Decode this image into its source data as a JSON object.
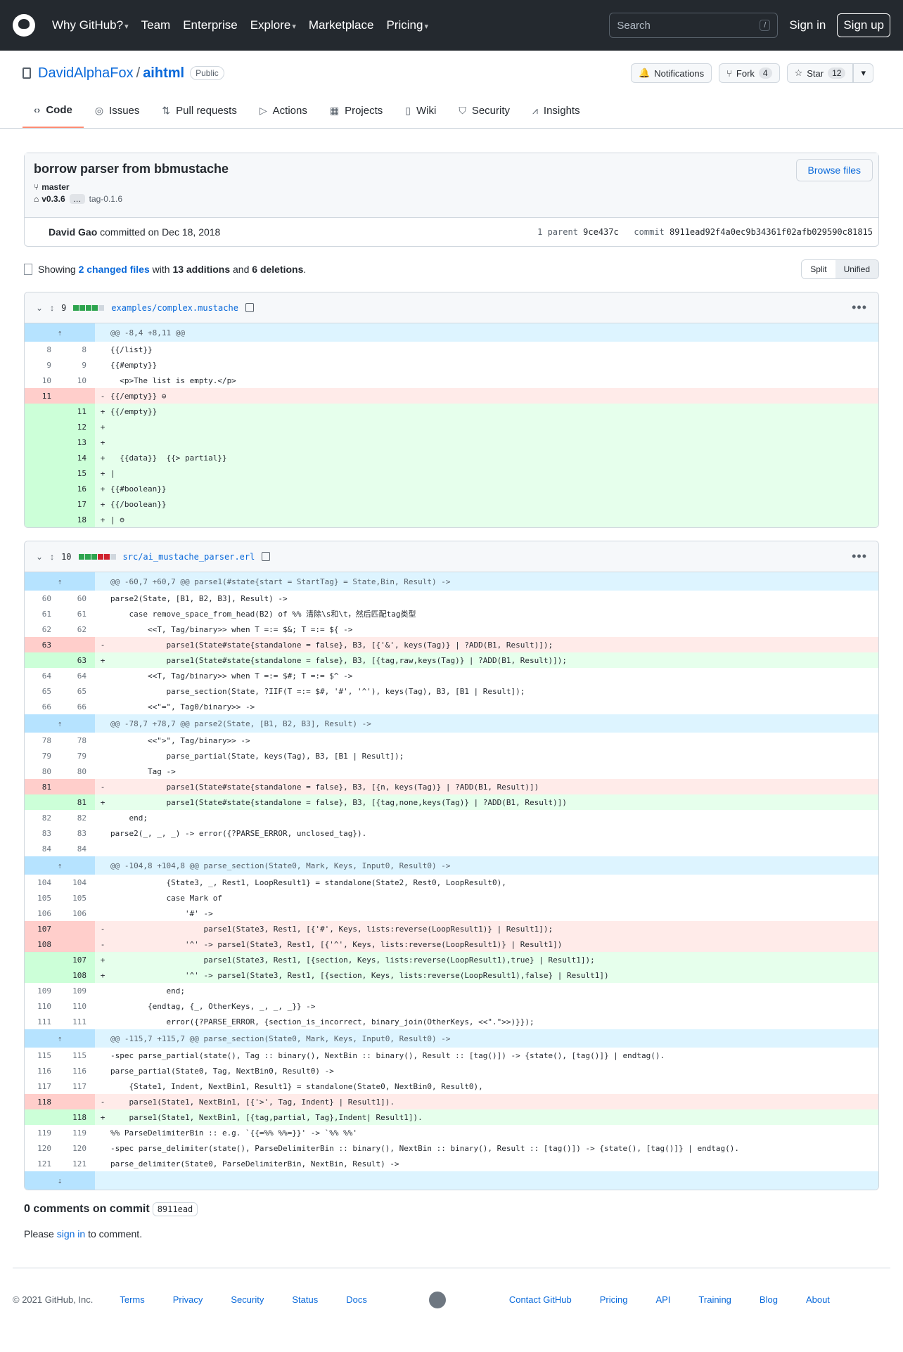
{
  "header": {
    "nav": [
      "Why GitHub?",
      "Team",
      "Enterprise",
      "Explore",
      "Marketplace",
      "Pricing"
    ],
    "nav_caret": [
      true,
      false,
      false,
      true,
      false,
      true
    ],
    "search_placeholder": "Search",
    "search_key": "/",
    "signin": "Sign in",
    "signup": "Sign up"
  },
  "repo": {
    "owner": "DavidAlphaFox",
    "sep": "/",
    "name": "aihtml",
    "visibility": "Public",
    "notifications": "Notifications",
    "fork": "Fork",
    "fork_count": "4",
    "star": "Star",
    "star_count": "12",
    "tabs": [
      {
        "label": "Code",
        "icon": "code-icon"
      },
      {
        "label": "Issues",
        "icon": "issue-icon"
      },
      {
        "label": "Pull requests",
        "icon": "pull-request-icon"
      },
      {
        "label": "Actions",
        "icon": "play-icon"
      },
      {
        "label": "Projects",
        "icon": "table-icon"
      },
      {
        "label": "Wiki",
        "icon": "book-icon"
      },
      {
        "label": "Security",
        "icon": "shield-icon"
      },
      {
        "label": "Insights",
        "icon": "graph-icon"
      }
    ]
  },
  "commit": {
    "title": "borrow parser from bbmustache",
    "browse": "Browse files",
    "branch": "master",
    "tag": "v0.3.6",
    "tag_more": "…",
    "tag2": "tag-0.1.6",
    "author": "David Gao",
    "committed": "committed on Dec 18, 2018",
    "parents": "1 parent",
    "parent_sha": "9ce437c",
    "commit_label": "commit",
    "commit_sha": "8911ead92f4a0ec9b34361f02afb029590c81815"
  },
  "summary": {
    "showing": "Showing",
    "changed": "2 changed files",
    "with": "with",
    "additions": "13 additions",
    "and": "and",
    "deletions": "6 deletions",
    "end": ".",
    "split": "Split",
    "unified": "Unified"
  },
  "files": [
    {
      "count": "9",
      "blocks": "ggggn",
      "path": "examples/complex.mustache",
      "lines": [
        [
          "h",
          "",
          "",
          "",
          "@@ -8,4 +8,11 @@"
        ],
        [
          "c",
          "8",
          "8",
          "",
          "{{/list}}"
        ],
        [
          "c",
          "9",
          "9",
          "",
          "{{#empty}}"
        ],
        [
          "c",
          "10",
          "10",
          "",
          "  <p>The list is empty.</p>"
        ],
        [
          "d",
          "11",
          "",
          "-",
          "{{/empty}} ⊖"
        ],
        [
          "a",
          "",
          "11",
          "+",
          "{{/empty}}"
        ],
        [
          "a",
          "",
          "12",
          "+",
          ""
        ],
        [
          "a",
          "",
          "13",
          "+",
          ""
        ],
        [
          "a",
          "",
          "14",
          "+",
          "  {{data}}  {{> partial}}"
        ],
        [
          "a",
          "",
          "15",
          "+",
          "|"
        ],
        [
          "a",
          "",
          "16",
          "+",
          "{{#boolean}}"
        ],
        [
          "a",
          "",
          "17",
          "+",
          "{{/boolean}}"
        ],
        [
          "a",
          "",
          "18",
          "+",
          "| ⊖"
        ]
      ]
    },
    {
      "count": "10",
      "blocks": "gggrrn",
      "path": "src/ai_mustache_parser.erl",
      "lines": [
        [
          "h",
          "",
          "",
          "",
          "@@ -60,7 +60,7 @@ parse1(#state{start = StartTag} = State,Bin, Result) ->"
        ],
        [
          "c",
          "60",
          "60",
          "",
          "parse2(State, [B1, B2, B3], Result) ->"
        ],
        [
          "c",
          "61",
          "61",
          "",
          "    case remove_space_from_head(B2) of %% 清除\\s和\\t，然后匹配tag类型"
        ],
        [
          "c",
          "62",
          "62",
          "",
          "        <<T, Tag/binary>> when T =:= $&; T =:= ${ ->"
        ],
        [
          "d",
          "63",
          "",
          "-",
          "            parse1(State#state{standalone = false}, B3, [{'&', keys(Tag)} | ?ADD(B1, Result)]);"
        ],
        [
          "a",
          "",
          "63",
          "+",
          "            parse1(State#state{standalone = false}, B3, [{tag,raw,keys(Tag)} | ?ADD(B1, Result)]);"
        ],
        [
          "c",
          "64",
          "64",
          "",
          "        <<T, Tag/binary>> when T =:= $#; T =:= $^ ->"
        ],
        [
          "c",
          "65",
          "65",
          "",
          "            parse_section(State, ?IIF(T =:= $#, '#', '^'), keys(Tag), B3, [B1 | Result]);"
        ],
        [
          "c",
          "66",
          "66",
          "",
          "        <<\"=\", Tag0/binary>> ->"
        ],
        [
          "h",
          "",
          "",
          "",
          "@@ -78,7 +78,7 @@ parse2(State, [B1, B2, B3], Result) ->"
        ],
        [
          "c",
          "78",
          "78",
          "",
          "        <<\">\", Tag/binary>> ->"
        ],
        [
          "c",
          "79",
          "79",
          "",
          "            parse_partial(State, keys(Tag), B3, [B1 | Result]);"
        ],
        [
          "c",
          "80",
          "80",
          "",
          "        Tag ->"
        ],
        [
          "d",
          "81",
          "",
          "-",
          "            parse1(State#state{standalone = false}, B3, [{n, keys(Tag)} | ?ADD(B1, Result)])"
        ],
        [
          "a",
          "",
          "81",
          "+",
          "            parse1(State#state{standalone = false}, B3, [{tag,none,keys(Tag)} | ?ADD(B1, Result)])"
        ],
        [
          "c",
          "82",
          "82",
          "",
          "    end;"
        ],
        [
          "c",
          "83",
          "83",
          "",
          "parse2(_, _, _) -> error({?PARSE_ERROR, unclosed_tag})."
        ],
        [
          "c",
          "84",
          "84",
          "",
          ""
        ],
        [
          "h",
          "",
          "",
          "",
          "@@ -104,8 +104,8 @@ parse_section(State0, Mark, Keys, Input0, Result0) ->"
        ],
        [
          "c",
          "104",
          "104",
          "",
          "            {State3, _, Rest1, LoopResult1} = standalone(State2, Rest0, LoopResult0),"
        ],
        [
          "c",
          "105",
          "105",
          "",
          "            case Mark of"
        ],
        [
          "c",
          "106",
          "106",
          "",
          "                '#' ->"
        ],
        [
          "d",
          "107",
          "",
          "-",
          "                    parse1(State3, Rest1, [{'#', Keys, lists:reverse(LoopResult1)} | Result1]);"
        ],
        [
          "d",
          "108",
          "",
          "-",
          "                '^' -> parse1(State3, Rest1, [{'^', Keys, lists:reverse(LoopResult1)} | Result1])"
        ],
        [
          "a",
          "",
          "107",
          "+",
          "                    parse1(State3, Rest1, [{section, Keys, lists:reverse(LoopResult1),true} | Result1]);"
        ],
        [
          "a",
          "",
          "108",
          "+",
          "                '^' -> parse1(State3, Rest1, [{section, Keys, lists:reverse(LoopResult1),false} | Result1])"
        ],
        [
          "c",
          "109",
          "109",
          "",
          "            end;"
        ],
        [
          "c",
          "110",
          "110",
          "",
          "        {endtag, {_, OtherKeys, _, _, _}} ->"
        ],
        [
          "c",
          "111",
          "111",
          "",
          "            error({?PARSE_ERROR, {section_is_incorrect, binary_join(OtherKeys, <<\".\">>)}});"
        ],
        [
          "h",
          "",
          "",
          "",
          "@@ -115,7 +115,7 @@ parse_section(State0, Mark, Keys, Input0, Result0) ->"
        ],
        [
          "c",
          "115",
          "115",
          "",
          "-spec parse_partial(state(), Tag :: binary(), NextBin :: binary(), Result :: [tag()]) -> {state(), [tag()]} | endtag()."
        ],
        [
          "c",
          "116",
          "116",
          "",
          "parse_partial(State0, Tag, NextBin0, Result0) ->"
        ],
        [
          "c",
          "117",
          "117",
          "",
          "    {State1, Indent, NextBin1, Result1} = standalone(State0, NextBin0, Result0),"
        ],
        [
          "d",
          "118",
          "",
          "-",
          "    parse1(State1, NextBin1, [{'>', Tag, Indent} | Result1])."
        ],
        [
          "a",
          "",
          "118",
          "+",
          "    parse1(State1, NextBin1, [{tag,partial, Tag},Indent| Result1])."
        ],
        [
          "c",
          "119",
          "119",
          "",
          "%% ParseDelimiterBin :: e.g. `{{=%% %%=}}' -> `%% %%'"
        ],
        [
          "c",
          "120",
          "120",
          "",
          "-spec parse_delimiter(state(), ParseDelimiterBin :: binary(), NextBin :: binary(), Result :: [tag()]) -> {state(), [tag()]} | endtag()."
        ],
        [
          "c",
          "121",
          "121",
          "",
          "parse_delimiter(State0, ParseDelimiterBin, NextBin, Result) ->"
        ],
        [
          "h",
          "",
          "",
          "",
          ""
        ]
      ]
    }
  ],
  "comments": {
    "title": "0 comments on commit",
    "sha": "8911ead",
    "please": "Please",
    "signin": "sign in",
    "to_comment": "to comment."
  },
  "footer": {
    "copyright": "© 2021 GitHub, Inc.",
    "links_left": [
      "Terms",
      "Privacy",
      "Security",
      "Status",
      "Docs"
    ],
    "links_right": [
      "Contact GitHub",
      "Pricing",
      "API",
      "Training",
      "Blog",
      "About"
    ]
  }
}
